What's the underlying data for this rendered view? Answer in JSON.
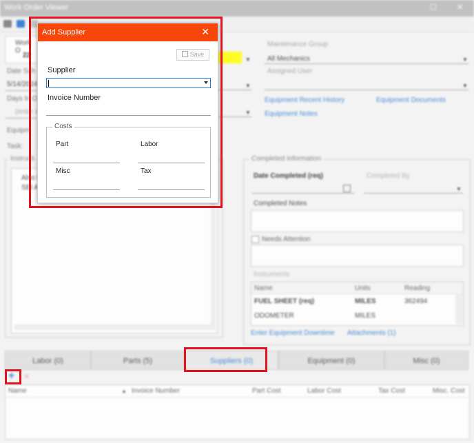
{
  "window": {
    "title": "Work Order Viewer",
    "controls": [
      "☐",
      "✕"
    ]
  },
  "background": {
    "work_order": {
      "label": "Work O",
      "number": "22"
    },
    "date_scheduled": {
      "label": "Date Sch",
      "value": "5/14/2024"
    },
    "days_in": {
      "label": "Days In O",
      "value": "(enter a"
    },
    "equipment_label": "Equipm",
    "task_label": "Task:",
    "instructions": {
      "label": "Instructi",
      "text_line1": "Also l",
      "text_line2": "SEI A"
    },
    "maintenance_group": {
      "label": "Maintenance Group",
      "value": "All Mechanics"
    },
    "assigned_user": {
      "label": "Assigned User",
      "value": ""
    },
    "links": {
      "recent_history": "Equipment Recent History",
      "documents": "Equipment Documents",
      "notes": "Equipment Notes",
      "downtime": "Enter Equipment Downtime",
      "attachments": "Attachments (1)"
    },
    "completed": {
      "group_title": "Completed Information",
      "date_completed": "Date Completed (req)",
      "completed_by": "Completed By",
      "notes_label": "Completed Notes",
      "needs_attention": "Needs Attention",
      "instruments_label": "Instruments"
    },
    "instruments_table": {
      "headers": [
        "Name",
        "Units",
        "Reading"
      ],
      "rows": [
        {
          "name": "FUEL SHEET (req)",
          "units": "MILES",
          "reading": "362494"
        },
        {
          "name": "ODOMETER",
          "units": "MILES",
          "reading": ""
        }
      ]
    },
    "tabs": [
      {
        "label": "Labor  (0)"
      },
      {
        "label": "Parts  (5)"
      },
      {
        "label": "Suppliers  (0)"
      },
      {
        "label": "Equipment  (0)"
      },
      {
        "label": "Misc  (0)"
      }
    ],
    "grid_columns": [
      "Name",
      "Invoice Number",
      "Part Cost",
      "Labor Cost",
      "Tax Cost",
      "Misc. Cost"
    ],
    "add_icon": "+",
    "delete_icon": "✕"
  },
  "dialog": {
    "title": "Add Supplier",
    "close": "✕",
    "save_label": "Save",
    "supplier_label": "Supplier",
    "supplier_value": "",
    "invoice_label": "Invoice Number",
    "invoice_value": "",
    "costs_title": "Costs",
    "part_label": "Part",
    "labor_label": "Labor",
    "misc_label": "Misc",
    "tax_label": "Tax"
  },
  "colors": {
    "accent": "#f6460a",
    "link": "#2a78d4",
    "highlight": "#e0141e",
    "yellow": "#ffff00"
  }
}
